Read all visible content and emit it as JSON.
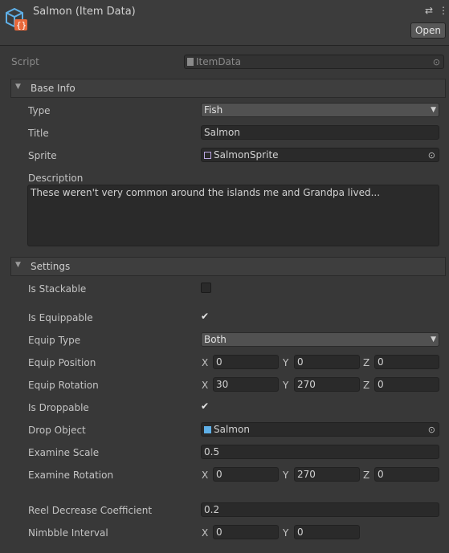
{
  "header": {
    "title": "Salmon (Item Data)",
    "open_label": "Open",
    "icon": "scriptable-object-icon",
    "settings_icon": "sliders-icon",
    "menu_icon": "kebab-menu-icon"
  },
  "script": {
    "label": "Script",
    "value": "ItemData"
  },
  "base_info": {
    "section_title": "Base Info",
    "type_label": "Type",
    "type_value": "Fish",
    "title_label": "Title",
    "title_value": "Salmon",
    "sprite_label": "Sprite",
    "sprite_value": "SalmonSprite",
    "description_label": "Description",
    "description_value": "These weren't very common around the islands me and Grandpa lived..."
  },
  "settings": {
    "section_title": "Settings",
    "is_stackable_label": "Is Stackable",
    "is_stackable": false,
    "is_equippable_label": "Is Equippable",
    "is_equippable": true,
    "equip_type_label": "Equip Type",
    "equip_type_value": "Both",
    "equip_position_label": "Equip Position",
    "equip_position": {
      "x": "0",
      "y": "0",
      "z": "0"
    },
    "equip_rotation_label": "Equip Rotation",
    "equip_rotation": {
      "x": "30",
      "y": "270",
      "z": "0"
    },
    "is_droppable_label": "Is Droppable",
    "is_droppable": true,
    "drop_object_label": "Drop Object",
    "drop_object_value": "Salmon",
    "examine_scale_label": "Examine Scale",
    "examine_scale_value": "0.5",
    "examine_rotation_label": "Examine Rotation",
    "examine_rotation": {
      "x": "0",
      "y": "270",
      "z": "0"
    },
    "reel_decrease_label": "Reel Decrease Coefficient",
    "reel_decrease_value": "0.2",
    "nimbble_interval_label": "Nimbble Interval",
    "nimbble_interval": {
      "x": "0",
      "y": "0"
    }
  },
  "axis": {
    "x": "X",
    "y": "Y",
    "z": "Z"
  },
  "glyphs": {
    "dropdown": "▼",
    "foldout": "▼",
    "check": "✔",
    "target": "⊙"
  }
}
